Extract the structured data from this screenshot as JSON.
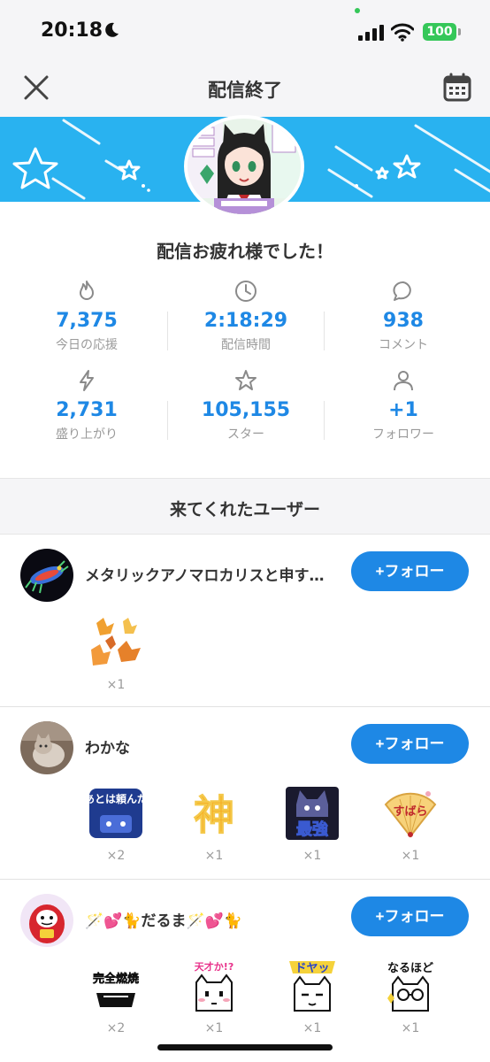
{
  "status_bar": {
    "time": "20:18",
    "battery": "100"
  },
  "nav": {
    "title": "配信終了"
  },
  "summary": {
    "message": "配信お疲れ様でした！"
  },
  "stats": [
    {
      "value": "7,375",
      "label": "今日の応援",
      "icon": "flame-icon"
    },
    {
      "value": "2:18:29",
      "label": "配信時間",
      "icon": "clock-icon"
    },
    {
      "value": "938",
      "label": "コメント",
      "icon": "comment-icon"
    },
    {
      "value": "2,731",
      "label": "盛り上がり",
      "icon": "lightning-icon"
    },
    {
      "value": "105,155",
      "label": "スター",
      "icon": "star-icon"
    },
    {
      "value": "+1",
      "label": "フォロワー",
      "icon": "person-icon"
    }
  ],
  "visitors_section": {
    "title": "来てくれたユーザー"
  },
  "users": [
    {
      "name": "メタリックアノマロカリスと申す…",
      "follow_label": "+フォロー",
      "gifts": [
        {
          "name": "autumn-leaves-sticker",
          "count": "×1"
        }
      ]
    },
    {
      "name": "わかな",
      "follow_label": "+フォロー",
      "gifts": [
        {
          "name": "atoha-tanonda-sticker",
          "text": "あとは頼んだ",
          "count": "×2"
        },
        {
          "name": "kami-sticker",
          "text": "神",
          "count": "×1"
        },
        {
          "name": "saikyou-sticker",
          "text": "最強",
          "count": "×1"
        },
        {
          "name": "subara-sticker",
          "text": "すばら",
          "count": "×1"
        }
      ]
    },
    {
      "name": "🪄💕🐈だるま🪄💕🐈",
      "follow_label": "+フォロー",
      "gifts": [
        {
          "name": "kanzen-nenshou-sticker",
          "text": "完全燃焼",
          "count": "×2"
        },
        {
          "name": "tensai-sticker",
          "text": "天才か!?",
          "count": "×1"
        },
        {
          "name": "doyah-sticker",
          "text": "ドヤッ",
          "count": "×1"
        },
        {
          "name": "naruhodo-sticker",
          "text": "なるほど",
          "count": "×1"
        }
      ]
    }
  ],
  "colors": {
    "accent": "#1e88e5",
    "banner": "#29b2f0",
    "muted": "#9a9a9a"
  }
}
